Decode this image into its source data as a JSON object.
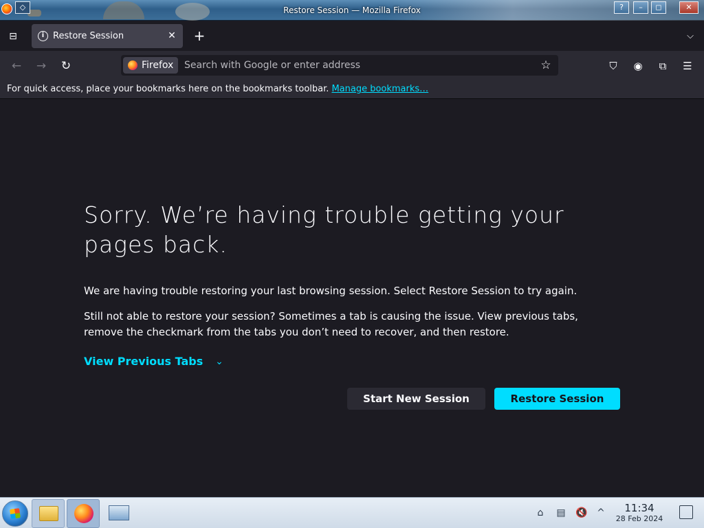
{
  "window": {
    "title": "Restore Session — Mozilla Firefox",
    "pin_glyph": "◇",
    "help_glyph": "?",
    "minimize_glyph": "–",
    "maximize_glyph": "◻",
    "close_glyph": "✕"
  },
  "tabs": {
    "list_all_glyph": "⊟",
    "active_tab": {
      "label": "Restore Session",
      "icon": "info-icon",
      "close_glyph": "✕"
    },
    "new_tab_glyph": "+",
    "overflow_glyph": "⌵"
  },
  "nav": {
    "back_glyph": "←",
    "forward_glyph": "→",
    "reload_glyph": "↻",
    "identity_label": "Firefox",
    "url_placeholder": "Search with Google or enter address",
    "bookmark_star_glyph": "☆",
    "pocket_glyph": "⛉",
    "account_glyph": "◉",
    "extensions_glyph": "⧉",
    "menu_glyph": "☰"
  },
  "bookmarks_bar": {
    "text": "For quick access, place your bookmarks here on the bookmarks toolbar.",
    "link": "Manage bookmarks…"
  },
  "page": {
    "headline": "Sorry. We’re having trouble getting your pages back.",
    "paragraph1": "We are having trouble restoring your last browsing session. Select Restore Session to try again.",
    "paragraph2": "Still not able to restore your session? Sometimes a tab is causing the issue. View previous tabs, remove the checkmark from the tabs you don’t need to recover, and then restore.",
    "view_previous_tabs": "View Previous Tabs",
    "chevron_glyph": "⌄",
    "start_new_session": "Start New Session",
    "restore_session": "Restore Session"
  },
  "taskbar": {
    "clock_time": "11:34",
    "clock_date": "28 Feb 2024",
    "tray_clipboard_glyph": "▤",
    "tray_volume_glyph": "🔇",
    "tray_expand_glyph": "^",
    "tray_network_glyph": "⌂"
  },
  "colors": {
    "accent": "#00ddff",
    "background": "#1c1b22",
    "toolbar": "#2b2a33",
    "tab_active": "#42414d"
  }
}
